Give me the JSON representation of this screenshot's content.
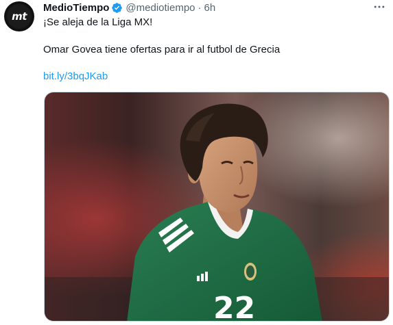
{
  "tweet": {
    "author": {
      "display_name": "MedioTiempo",
      "handle": "@mediotiempo",
      "verified": true,
      "avatar_text": "mt"
    },
    "separator": "·",
    "time": "6h",
    "more_icon": "more-horizontal-icon",
    "text_lines": [
      "¡Se aleja de la Liga MX!",
      "Omar Govea tiene ofertas para ir al futbol de Grecia"
    ],
    "link": "bit.ly/3bqJKab",
    "media": {
      "jersey_number": "22",
      "brand": "adidas"
    }
  },
  "colors": {
    "link": "#1d9bf0",
    "verified": "#1d9bf0",
    "secondary_text": "#536471",
    "jersey_green": "#1f6b45"
  }
}
